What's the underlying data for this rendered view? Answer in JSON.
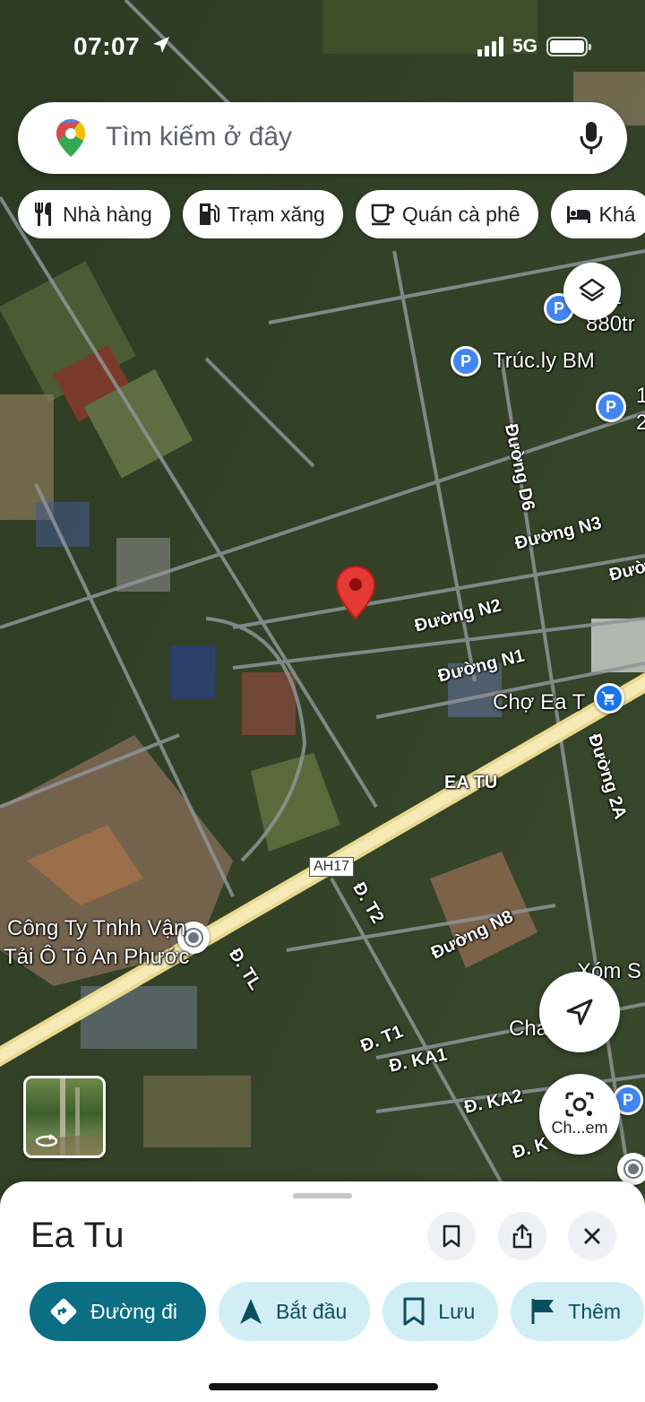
{
  "status_bar": {
    "time": "07:07",
    "network": "5G"
  },
  "search": {
    "placeholder": "Tìm kiếm ở đây"
  },
  "chips": [
    {
      "label": "Nhà hàng",
      "icon": "restaurant-icon"
    },
    {
      "label": "Trạm xăng",
      "icon": "gas-station-icon"
    },
    {
      "label": "Quán cà phê",
      "icon": "coffee-icon"
    },
    {
      "label": "Khá",
      "icon": "hotel-icon"
    }
  ],
  "map": {
    "pois": {
      "poi_1_line1": "351",
      "poi_1_line2": "880tr",
      "truc_ly": "Trúc.ly BM",
      "poi_edge_1": "1",
      "poi_edge_2": "2",
      "market": "Chợ Ea T",
      "company_line1": "Công Ty Tnhh Vận",
      "company_line2": "Tải Ô Tô An Phước",
      "xom": "Xóm S",
      "cha": "Cha   ng l"
    },
    "roads": {
      "d6": "Đường D6",
      "n3": "Đường N3",
      "edge": "Đườ",
      "n2": "Đường N2",
      "n1": "Đường N1",
      "d2a": "Đường 2A",
      "ea_tu": "EA TU",
      "ah17": "AH17",
      "t2": "Đ. T2",
      "n8": "Đường N8",
      "tl": "Đ. TL",
      "t1": "Đ. T1",
      "ka1": "Đ. KA1",
      "ka2": "Đ. KA2",
      "k": "Đ. K"
    }
  },
  "lens": {
    "label": "Ch...em"
  },
  "place": {
    "title": "Ea Tu"
  },
  "actions": [
    {
      "label": "Đường đi",
      "icon": "directions-icon"
    },
    {
      "label": "Bắt đầu",
      "icon": "navigation-arrow-icon"
    },
    {
      "label": "Lưu",
      "icon": "bookmark-icon"
    },
    {
      "label": "Thêm",
      "icon": "flag-icon"
    }
  ],
  "colors": {
    "primary": "#0b6e82",
    "secondary_chip": "#d2eef5",
    "pin": "#e53935",
    "poi": "#4285f4",
    "highway": "#f2e3a0"
  }
}
